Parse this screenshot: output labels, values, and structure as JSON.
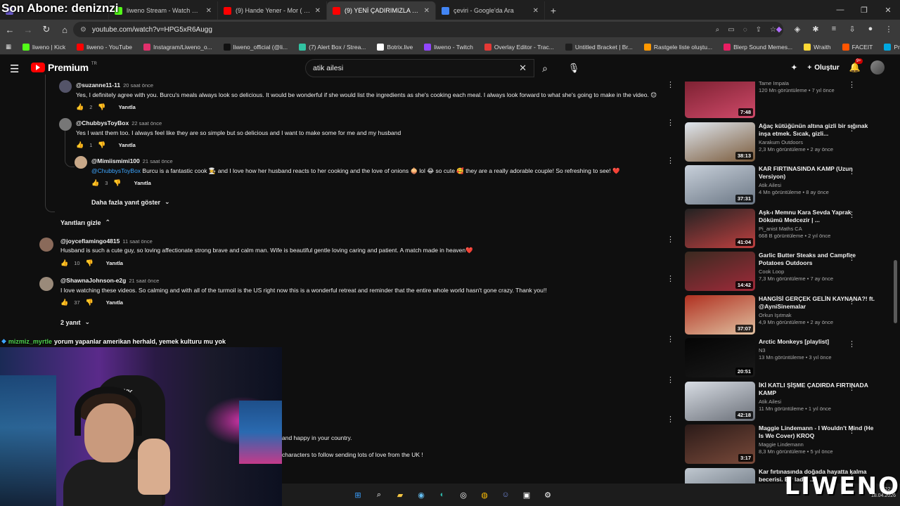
{
  "overlay": {
    "title": "Son Abone: deniznzi"
  },
  "browser": {
    "tabs": [
      {
        "label": "",
        "color": "#6a5acd",
        "active": false
      },
      {
        "label": "liweno Stream - Watch Live on",
        "color": "#53fc18",
        "active": false
      },
      {
        "label": "(9) Hande Yener - Mor ( Official",
        "color": "#ff0000",
        "active": false
      },
      {
        "label": "(9) YENİ ÇADIRIMIZLA EV KONF",
        "color": "#ff0000",
        "active": true
      },
      {
        "label": "çeviri - Google'da Ara",
        "color": "#4285f4",
        "active": false
      }
    ],
    "url": "youtube.com/watch?v=HPG5xR6Augg",
    "bookmarks": [
      {
        "label": "liweno | Kick",
        "color": "#53fc18"
      },
      {
        "label": "liweno - YouTube",
        "color": "#ff0000"
      },
      {
        "label": "Instagram/Liweno_o...",
        "color": "#e1306c"
      },
      {
        "label": "liweno_official (@li...",
        "color": "#111111"
      },
      {
        "label": "(7) Alert Box / Strea...",
        "color": "#31c3a2"
      },
      {
        "label": "Botrix.live",
        "color": "#ffffff"
      },
      {
        "label": "liweno - Twitch",
        "color": "#9146ff"
      },
      {
        "label": "Overlay Editor - Trac...",
        "color": "#e53935"
      },
      {
        "label": "Untitled Bracket | Br...",
        "color": "#1e1e1e"
      },
      {
        "label": "Rastgele liste oluştu...",
        "color": "#ff9800"
      },
      {
        "label": "Blerp Sound Memes...",
        "color": "#e91e63"
      },
      {
        "label": "Wraith",
        "color": "#fdd835"
      },
      {
        "label": "FACEIT",
        "color": "#ff5500"
      },
      {
        "label": "Prime Video",
        "color": "#00a8e1"
      }
    ]
  },
  "yt": {
    "logo": "Premium",
    "region": "TR",
    "search_value": "atik ailesi",
    "create_label": "Oluştur",
    "bell_badge": "9+"
  },
  "comments": [
    {
      "author": "@suzanne11-11",
      "time": "20 saat önce",
      "text": "Yes, I definitely agree with you. Burcu's meals always look so delicious. It would be wonderful if she would list the ingredients as she's cooking each meal. I always look forward to what she's going to make in the video. 😊",
      "likes": "2",
      "reply": "Yanıtla"
    },
    {
      "author": "@ChubbysToyBox",
      "time": "22 saat önce",
      "text": "Yes I want them too. I always feel like they are so simple but so delicious and I want to make some for me and my husband",
      "likes": "1",
      "reply": "Yanıtla"
    },
    {
      "author": "@Mimiismimi100",
      "time": "21 saat önce",
      "mention": "@ChubbysToyBox",
      "text": " Burcu is a fantastic cook 👩‍🍳 and I love how her husband reacts to her cooking and the love of onions 🧅 lol 😂 so cute 🥰 they are a really adorable couple! So refreshing to see! ❤️",
      "likes": "3",
      "reply": "Yanıtla"
    },
    {
      "author": "@joyceflamingo4815",
      "time": "11 saat önce",
      "text": "Husband is such a cute guy, so loving affectionate strong brave and  calm man. Wife is beautiful gentle loving caring and patient. A match made in heaven❤️",
      "likes": "10",
      "reply": "Yanıtla"
    },
    {
      "author": "@ShawnaJohnson-e2g",
      "time": "21 saat önce",
      "text": "I love watching these videos.  So calming and with all of the turmoil is the US right now this is a wonderful retreat and reminder that  the entire whole world hasn't gone crazy.  Thank you!!",
      "likes": "37",
      "reply": "Yanıtla"
    }
  ],
  "toggles": {
    "more_replies": "Daha fazla yanıt göster",
    "hide_replies": "Yanıtları gizle",
    "two_replies": "2 yanıt"
  },
  "fragments": {
    "f1": "and happy in your country.",
    "f2": "characters to follow sending lots of love from the UK !"
  },
  "chat": {
    "user": "mizmiz_myrtle",
    "message": "yorum yapanlar amerikan herhald, yemek kulturu mu yok"
  },
  "webcam": {
    "chair_logo": "HAWK"
  },
  "sidebar": [
    {
      "title": "",
      "channel": "Tame Impala",
      "meta": "120 Mn görüntüleme • 7 yıl önce",
      "duration": "7:48",
      "c1": "#7a2030",
      "c2": "#d04a6a"
    },
    {
      "title": "Ağaç kütüğünün altına gizli bir sığınak inşa etmek. Sıcak, gizli...",
      "channel": "Karakum Outdoors",
      "meta": "2,3 Mn görüntüleme • 2 ay önce",
      "duration": "38:13",
      "c1": "#dfe6ee",
      "c2": "#7a5a3a"
    },
    {
      "title": "KAR FIRTINASINDA KAMP (Uzun Versiyon)",
      "channel": "Atik Ailesi",
      "meta": "4 Mn görüntüleme • 8 ay önce",
      "duration": "37:31",
      "c1": "#c8d0da",
      "c2": "#6a7684"
    },
    {
      "title": "Aşk-ı Memnu Kara Sevda Yaprak Dökümü Medcezir | ...",
      "channel": "Pi_anist Maths CA",
      "meta": "668 B görüntüleme • 2 yıl önce",
      "duration": "41:04",
      "c1": "#222222",
      "c2": "#c04040"
    },
    {
      "title": "Garlic Butter Steaks and Campfire Potatoes Outdoors",
      "channel": "Cook Loop",
      "meta": "7,3 Mn görüntüleme • 7 ay önce",
      "duration": "14:42",
      "c1": "#3a2a20",
      "c2": "#a02a3a"
    },
    {
      "title": "HANGİSİ GERÇEK GELİN KAYNANA?! ft. @AyniSinemalar",
      "channel": "Orkun Işıtmak",
      "meta": "4,9 Mn görüntüleme • 2 ay önce",
      "duration": "37:07",
      "c1": "#b03020",
      "c2": "#e0c0a0"
    },
    {
      "title": "Arctic Monkeys [playlist]",
      "channel": "N3",
      "meta": "13 Mn görüntüleme • 3 yıl önce",
      "duration": "20:51",
      "c1": "#050505",
      "c2": "#1a1a1a"
    },
    {
      "title": "İKİ KATLI ŞİŞME ÇADIRDA FIRTINADA KAMP",
      "channel": "Atik Ailesi",
      "meta": "11 Mn görüntüleme • 1 yıl önce",
      "duration": "42:18",
      "c1": "#d8dde4",
      "c2": "#6a6f78"
    },
    {
      "title": "Maggie Lindemann - I Wouldn't Mind (He Is We Cover) KROQ",
      "channel": "Maggie Lindemann",
      "meta": "8,3 Mn görüntüleme • 5 yıl önce",
      "duration": "3:17",
      "c1": "#2a1a18",
      "c2": "#7a4a3a"
    },
    {
      "title": "Kar fırtınasında doğada hayatta kalma becerisi. Bir ladin ...",
      "channel": "",
      "meta": "",
      "duration": "",
      "c1": "#c0c8d0",
      "c2": "#5a6470"
    }
  ],
  "watermark": "LIWENO",
  "clock": {
    "time": "22:...",
    "date": "18.04.2026"
  }
}
